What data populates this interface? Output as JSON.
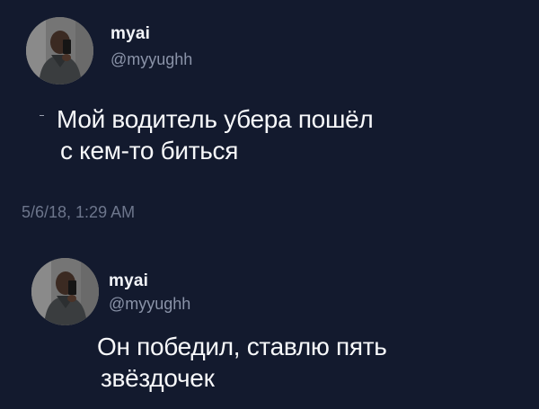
{
  "tweets": [
    {
      "user": {
        "display_name": "myai",
        "handle": "@myyughh"
      },
      "text_lines": [
        "Мой водитель убера пошёл",
        "с кем-то биться"
      ],
      "timestamp": "5/6/18, 1:29 AM"
    },
    {
      "user": {
        "display_name": "myai",
        "handle": "@myyughh"
      },
      "text_lines": [
        "Он победил, ставлю пять",
        "звёздочек"
      ]
    }
  ],
  "colors": {
    "background": "#131a2e",
    "text": "#f7f8fa",
    "secondary_text": "#8a93a8"
  }
}
